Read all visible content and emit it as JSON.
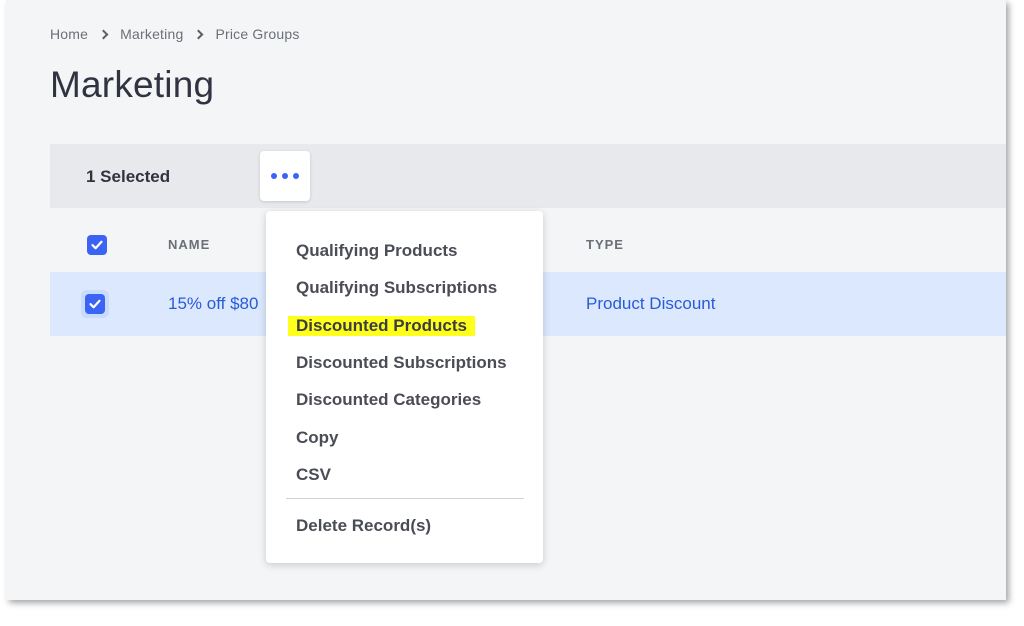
{
  "breadcrumb": [
    "Home",
    "Marketing",
    "Price Groups"
  ],
  "page_title": "Marketing",
  "selection": {
    "count_label": "1 Selected"
  },
  "table": {
    "headers": {
      "name": "NAME",
      "type": "TYPE"
    },
    "rows": [
      {
        "name": "15% off $80",
        "type": "Product Discount",
        "checked": true
      }
    ]
  },
  "menu": {
    "items": [
      "Qualifying Products",
      "Qualifying Subscriptions",
      "Discounted Products",
      "Discounted Subscriptions",
      "Discounted Categories",
      "Copy",
      "CSV"
    ],
    "highlighted_item": "Discounted Products",
    "danger_item": "Delete Record(s)"
  },
  "colors": {
    "accent": "#3c64f4",
    "highlight": "#ffff1c",
    "row_selected": "#dbe8fd"
  }
}
